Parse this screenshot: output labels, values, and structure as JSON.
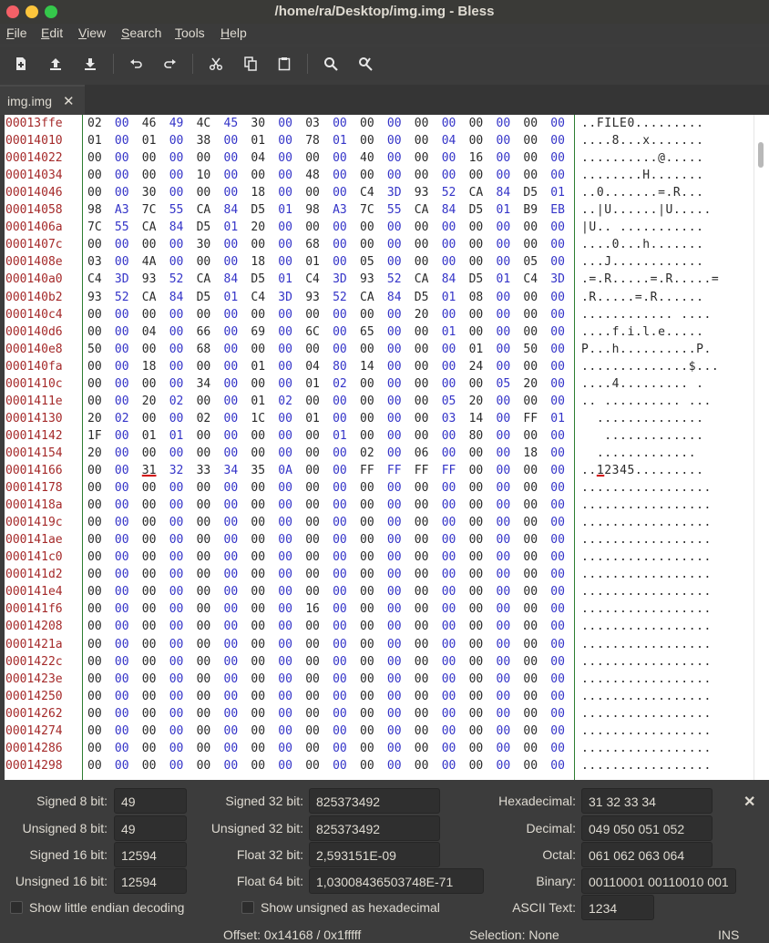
{
  "window": {
    "title": "/home/ra/Desktop/img.img - Bless"
  },
  "menu": [
    "File",
    "Edit",
    "View",
    "Search",
    "Tools",
    "Help"
  ],
  "toolbar": [
    "new-file-icon",
    "open-file-icon",
    "save-file-icon",
    "undo-icon",
    "redo-icon",
    "cut-icon",
    "copy-icon",
    "paste-icon",
    "find-icon",
    "find-replace-icon"
  ],
  "tab": {
    "label": "img.img",
    "close": "✕"
  },
  "offsets": [
    "00013ffe",
    "00014010",
    "00014022",
    "00014034",
    "00014046",
    "00014058",
    "0001406a",
    "0001407c",
    "0001408e",
    "000140a0",
    "000140b2",
    "000140c4",
    "000140d6",
    "000140e8",
    "000140fa",
    "0001410c",
    "0001411e",
    "00014130",
    "00014142",
    "00014154",
    "00014166",
    "00014178",
    "0001418a",
    "0001419c",
    "000141ae",
    "000141c0",
    "000141d2",
    "000141e4",
    "000141f6",
    "00014208",
    "0001421a",
    "0001422c",
    "0001423e",
    "00014250",
    "00014262",
    "00014274",
    "00014286",
    "00014298"
  ],
  "hex": [
    [
      "02",
      "00",
      "46",
      "49",
      "4C",
      "45",
      "30",
      "00",
      "03",
      "00",
      "00",
      "00",
      "00",
      "00",
      "00",
      "00",
      "00",
      "00"
    ],
    [
      "01",
      "00",
      "01",
      "00",
      "38",
      "00",
      "01",
      "00",
      "78",
      "01",
      "00",
      "00",
      "00",
      "04",
      "00",
      "00",
      "00",
      "00"
    ],
    [
      "00",
      "00",
      "00",
      "00",
      "00",
      "00",
      "04",
      "00",
      "00",
      "00",
      "40",
      "00",
      "00",
      "00",
      "16",
      "00",
      "00",
      "00"
    ],
    [
      "00",
      "00",
      "00",
      "00",
      "10",
      "00",
      "00",
      "00",
      "48",
      "00",
      "00",
      "00",
      "00",
      "00",
      "00",
      "00",
      "00",
      "00"
    ],
    [
      "00",
      "00",
      "30",
      "00",
      "00",
      "00",
      "18",
      "00",
      "00",
      "00",
      "C4",
      "3D",
      "93",
      "52",
      "CA",
      "84",
      "D5",
      "01"
    ],
    [
      "98",
      "A3",
      "7C",
      "55",
      "CA",
      "84",
      "D5",
      "01",
      "98",
      "A3",
      "7C",
      "55",
      "CA",
      "84",
      "D5",
      "01",
      "B9",
      "EB"
    ],
    [
      "7C",
      "55",
      "CA",
      "84",
      "D5",
      "01",
      "20",
      "00",
      "00",
      "00",
      "00",
      "00",
      "00",
      "00",
      "00",
      "00",
      "00",
      "00"
    ],
    [
      "00",
      "00",
      "00",
      "00",
      "30",
      "00",
      "00",
      "00",
      "68",
      "00",
      "00",
      "00",
      "00",
      "00",
      "00",
      "00",
      "00",
      "00"
    ],
    [
      "03",
      "00",
      "4A",
      "00",
      "00",
      "00",
      "18",
      "00",
      "01",
      "00",
      "05",
      "00",
      "00",
      "00",
      "00",
      "00",
      "05",
      "00"
    ],
    [
      "C4",
      "3D",
      "93",
      "52",
      "CA",
      "84",
      "D5",
      "01",
      "C4",
      "3D",
      "93",
      "52",
      "CA",
      "84",
      "D5",
      "01",
      "C4",
      "3D"
    ],
    [
      "93",
      "52",
      "CA",
      "84",
      "D5",
      "01",
      "C4",
      "3D",
      "93",
      "52",
      "CA",
      "84",
      "D5",
      "01",
      "08",
      "00",
      "00",
      "00"
    ],
    [
      "00",
      "00",
      "00",
      "00",
      "00",
      "00",
      "00",
      "00",
      "00",
      "00",
      "00",
      "00",
      "20",
      "00",
      "00",
      "00",
      "00",
      "00"
    ],
    [
      "00",
      "00",
      "04",
      "00",
      "66",
      "00",
      "69",
      "00",
      "6C",
      "00",
      "65",
      "00",
      "00",
      "01",
      "00",
      "00",
      "00",
      "00"
    ],
    [
      "50",
      "00",
      "00",
      "00",
      "68",
      "00",
      "00",
      "00",
      "00",
      "00",
      "00",
      "00",
      "00",
      "00",
      "01",
      "00",
      "50",
      "00"
    ],
    [
      "00",
      "00",
      "18",
      "00",
      "00",
      "00",
      "01",
      "00",
      "04",
      "80",
      "14",
      "00",
      "00",
      "00",
      "24",
      "00",
      "00",
      "00"
    ],
    [
      "00",
      "00",
      "00",
      "00",
      "34",
      "00",
      "00",
      "00",
      "01",
      "02",
      "00",
      "00",
      "00",
      "00",
      "00",
      "05",
      "20",
      "00"
    ],
    [
      "00",
      "00",
      "20",
      "02",
      "00",
      "00",
      "01",
      "02",
      "00",
      "00",
      "00",
      "00",
      "00",
      "05",
      "20",
      "00",
      "00",
      "00"
    ],
    [
      "20",
      "02",
      "00",
      "00",
      "02",
      "00",
      "1C",
      "00",
      "01",
      "00",
      "00",
      "00",
      "00",
      "03",
      "14",
      "00",
      "FF",
      "01"
    ],
    [
      "1F",
      "00",
      "01",
      "01",
      "00",
      "00",
      "00",
      "00",
      "00",
      "01",
      "00",
      "00",
      "00",
      "00",
      "80",
      "00",
      "00",
      "00"
    ],
    [
      "20",
      "00",
      "00",
      "00",
      "00",
      "00",
      "00",
      "00",
      "00",
      "00",
      "02",
      "00",
      "06",
      "00",
      "00",
      "00",
      "18",
      "00"
    ],
    [
      "00",
      "00",
      "31",
      "32",
      "33",
      "34",
      "35",
      "0A",
      "00",
      "00",
      "FF",
      "FF",
      "FF",
      "FF",
      "00",
      "00",
      "00",
      "00"
    ],
    [
      "00",
      "00",
      "00",
      "00",
      "00",
      "00",
      "00",
      "00",
      "00",
      "00",
      "00",
      "00",
      "00",
      "00",
      "00",
      "00",
      "00",
      "00"
    ],
    [
      "00",
      "00",
      "00",
      "00",
      "00",
      "00",
      "00",
      "00",
      "00",
      "00",
      "00",
      "00",
      "00",
      "00",
      "00",
      "00",
      "00",
      "00"
    ],
    [
      "00",
      "00",
      "00",
      "00",
      "00",
      "00",
      "00",
      "00",
      "00",
      "00",
      "00",
      "00",
      "00",
      "00",
      "00",
      "00",
      "00",
      "00"
    ],
    [
      "00",
      "00",
      "00",
      "00",
      "00",
      "00",
      "00",
      "00",
      "00",
      "00",
      "00",
      "00",
      "00",
      "00",
      "00",
      "00",
      "00",
      "00"
    ],
    [
      "00",
      "00",
      "00",
      "00",
      "00",
      "00",
      "00",
      "00",
      "00",
      "00",
      "00",
      "00",
      "00",
      "00",
      "00",
      "00",
      "00",
      "00"
    ],
    [
      "00",
      "00",
      "00",
      "00",
      "00",
      "00",
      "00",
      "00",
      "00",
      "00",
      "00",
      "00",
      "00",
      "00",
      "00",
      "00",
      "00",
      "00"
    ],
    [
      "00",
      "00",
      "00",
      "00",
      "00",
      "00",
      "00",
      "00",
      "00",
      "00",
      "00",
      "00",
      "00",
      "00",
      "00",
      "00",
      "00",
      "00"
    ],
    [
      "00",
      "00",
      "00",
      "00",
      "00",
      "00",
      "00",
      "00",
      "16",
      "00",
      "00",
      "00",
      "00",
      "00",
      "00",
      "00",
      "00",
      "00"
    ],
    [
      "00",
      "00",
      "00",
      "00",
      "00",
      "00",
      "00",
      "00",
      "00",
      "00",
      "00",
      "00",
      "00",
      "00",
      "00",
      "00",
      "00",
      "00"
    ],
    [
      "00",
      "00",
      "00",
      "00",
      "00",
      "00",
      "00",
      "00",
      "00",
      "00",
      "00",
      "00",
      "00",
      "00",
      "00",
      "00",
      "00",
      "00"
    ],
    [
      "00",
      "00",
      "00",
      "00",
      "00",
      "00",
      "00",
      "00",
      "00",
      "00",
      "00",
      "00",
      "00",
      "00",
      "00",
      "00",
      "00",
      "00"
    ],
    [
      "00",
      "00",
      "00",
      "00",
      "00",
      "00",
      "00",
      "00",
      "00",
      "00",
      "00",
      "00",
      "00",
      "00",
      "00",
      "00",
      "00",
      "00"
    ],
    [
      "00",
      "00",
      "00",
      "00",
      "00",
      "00",
      "00",
      "00",
      "00",
      "00",
      "00",
      "00",
      "00",
      "00",
      "00",
      "00",
      "00",
      "00"
    ],
    [
      "00",
      "00",
      "00",
      "00",
      "00",
      "00",
      "00",
      "00",
      "00",
      "00",
      "00",
      "00",
      "00",
      "00",
      "00",
      "00",
      "00",
      "00"
    ],
    [
      "00",
      "00",
      "00",
      "00",
      "00",
      "00",
      "00",
      "00",
      "00",
      "00",
      "00",
      "00",
      "00",
      "00",
      "00",
      "00",
      "00",
      "00"
    ],
    [
      "00",
      "00",
      "00",
      "00",
      "00",
      "00",
      "00",
      "00",
      "00",
      "00",
      "00",
      "00",
      "00",
      "00",
      "00",
      "00",
      "00",
      "00"
    ],
    [
      "00",
      "00",
      "00",
      "00",
      "00",
      "00",
      "00",
      "00",
      "00",
      "00",
      "00",
      "00",
      "00",
      "00",
      "00",
      "00",
      "00",
      "00"
    ]
  ],
  "ascii": [
    "..FILE0.........",
    "....8...x.......",
    "..........@.....",
    "........H.......",
    "..0.......=.R...",
    "..|U......|U.....",
    "|U.. ...........",
    "....0...h.......",
    "...J............",
    ".=.R.....=.R.....=",
    ".R.....=.R......",
    "............ ....",
    "....f.i.l.e.....",
    "P...h..........P.",
    "..............$...",
    "....4......... .",
    ".. .......... ...",
    "  ..............",
    "   .............",
    "  .............",
    "..12345.........",
    ".................",
    ".................",
    ".................",
    ".................",
    ".................",
    ".................",
    ".................",
    ".................",
    ".................",
    ".................",
    ".................",
    ".................",
    ".................",
    ".................",
    ".................",
    ".................",
    "................."
  ],
  "selection": {
    "row": 20,
    "col": 2,
    "ascii_col": 2
  },
  "colors": {
    "offset": "#a52a2a",
    "hex_even": "#2a2a2a",
    "hex_odd": "#3434c8",
    "divider": "#2e7d32",
    "cursor": "#d10000"
  },
  "panel": {
    "signed8_label": "Signed 8 bit:",
    "signed8": "49",
    "unsigned8_label": "Unsigned 8 bit:",
    "unsigned8": "49",
    "signed16_label": "Signed 16 bit:",
    "signed16": "12594",
    "unsigned16_label": "Unsigned 16 bit:",
    "unsigned16": "12594",
    "signed32_label": "Signed 32 bit:",
    "signed32": "825373492",
    "unsigned32_label": "Unsigned 32 bit:",
    "unsigned32": "825373492",
    "float32_label": "Float 32 bit:",
    "float32": "2,593151E-09",
    "float64_label": "Float 64 bit:",
    "float64": "1,03008436503748E-71",
    "hex_label": "Hexadecimal:",
    "hex": "31 32 33 34",
    "dec_label": "Decimal:",
    "dec": "049 050 051 052",
    "oct_label": "Octal:",
    "oct": "061 062 063 064",
    "bin_label": "Binary:",
    "bin": "00110001 00110010 001",
    "ascii_label": "ASCII Text:",
    "ascii": "1234",
    "little_endian_label": "Show little endian decoding",
    "unsigned_hex_label": "Show unsigned as hexadecimal",
    "close": "✕"
  },
  "status": {
    "offset": "Offset: 0x14168 / 0x1fffff",
    "selection": "Selection: None",
    "mode": "INS"
  }
}
